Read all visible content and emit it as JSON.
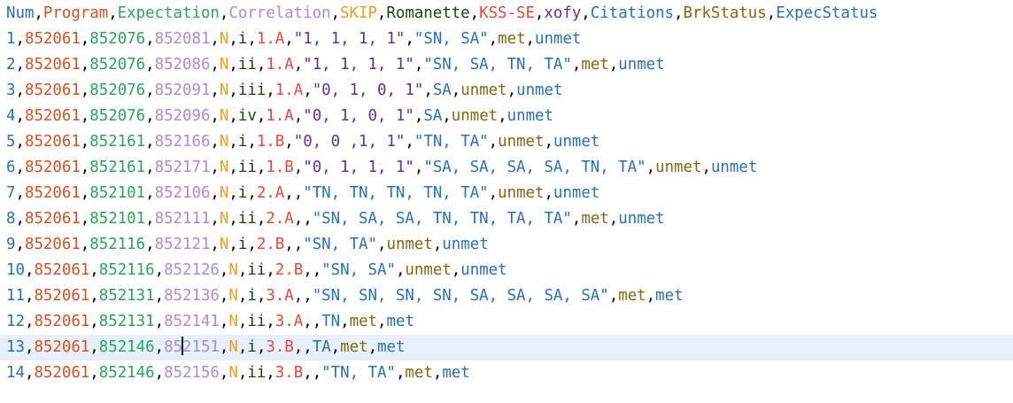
{
  "editor": {
    "cursor": {
      "line": 13,
      "column": 3,
      "offset": 2
    },
    "colors": {
      "col0": "#2a6fb7",
      "col1": "#d35228",
      "col2": "#2ea35a",
      "col3": "#a98bdc",
      "col4": "#f39c2a",
      "col5": "#1f3e16",
      "col6": "#e8493b",
      "col7": "#5a32a3",
      "col8": "#2a6fb7",
      "col9": "#7d6a16",
      "col10": "#2a6fb7",
      "current_line_bg": "#e8f0fb"
    },
    "lines": [
      [
        "Num",
        "Program",
        "Expectation",
        "Correlation",
        "SKIP",
        "Romanette",
        "KSS-SE",
        "xofy",
        "Citations",
        "BrkStatus",
        "ExpecStatus"
      ],
      [
        "1",
        "852061",
        "852076",
        "852081",
        "N",
        "i",
        "1.A",
        "\"1, 1, 1, 1\"",
        "\"SN, SA\"",
        "met",
        "unmet"
      ],
      [
        "2",
        "852061",
        "852076",
        "852086",
        "N",
        "ii",
        "1.A",
        "\"1, 1, 1, 1\"",
        "\"SN, SA, TN, TA\"",
        "met",
        "unmet"
      ],
      [
        "3",
        "852061",
        "852076",
        "852091",
        "N",
        "iii",
        "1.A",
        "\"0, 1, 0, 1\"",
        "SA",
        "unmet",
        "unmet"
      ],
      [
        "4",
        "852061",
        "852076",
        "852096",
        "N",
        "iv",
        "1.A",
        "\"0, 1, 0, 1\"",
        "SA",
        "unmet",
        "unmet"
      ],
      [
        "5",
        "852061",
        "852161",
        "852166",
        "N",
        "i",
        "1.B",
        "\"0, 0 ,1, 1\"",
        "\"TN, TA\"",
        "unmet",
        "unmet"
      ],
      [
        "6",
        "852061",
        "852161",
        "852171",
        "N",
        "ii",
        "1.B",
        "\"0, 1, 1, 1\"",
        "\"SA, SA, SA, SA, TN, TA\"",
        "unmet",
        "unmet"
      ],
      [
        "7",
        "852061",
        "852101",
        "852106",
        "N",
        "i",
        "2.A",
        "",
        "\"TN, TN, TN, TN, TA\"",
        "unmet",
        "unmet"
      ],
      [
        "8",
        "852061",
        "852101",
        "852111",
        "N",
        "ii",
        "2.A",
        "",
        "\"SN, SA, SA, TN, TN, TA, TA\"",
        "met",
        "unmet"
      ],
      [
        "9",
        "852061",
        "852116",
        "852121",
        "N",
        "i",
        "2.B",
        "",
        "\"SN, TA\"",
        "unmet",
        "unmet"
      ],
      [
        "10",
        "852061",
        "852116",
        "852126",
        "N",
        "ii",
        "2.B",
        "",
        "\"SN, SA\"",
        "unmet",
        "unmet"
      ],
      [
        "11",
        "852061",
        "852131",
        "852136",
        "N",
        "i",
        "3.A",
        "",
        "\"SN, SN, SN, SN, SA, SA, SA, SA\"",
        "met",
        "met"
      ],
      [
        "12",
        "852061",
        "852131",
        "852141",
        "N",
        "ii",
        "3.A",
        "",
        "TN",
        "met",
        "met"
      ],
      [
        "13",
        "852061",
        "852146",
        "852151",
        "N",
        "i",
        "3.B",
        "",
        "TA",
        "met",
        "met"
      ],
      [
        "14",
        "852061",
        "852146",
        "852156",
        "N",
        "ii",
        "3.B",
        "",
        "\"TN, TA\"",
        "met",
        "met"
      ]
    ]
  }
}
